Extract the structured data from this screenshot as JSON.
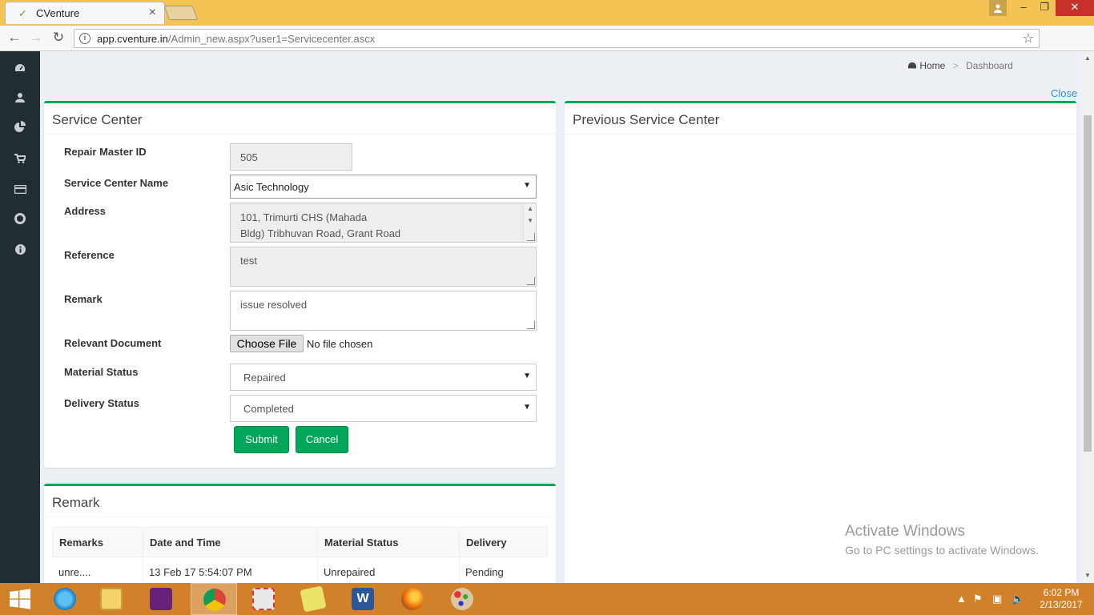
{
  "browser": {
    "tab_title": "CVenture",
    "url_host": "app.cventure.in",
    "url_path": "/Admin_new.aspx?user1=Servicecenter.ascx"
  },
  "breadcrumb": {
    "home": "Home",
    "separator": ">",
    "current": "Dashboard"
  },
  "close_label": "Close",
  "sidebar": {
    "items": [
      {
        "icon": "dashboard-icon"
      },
      {
        "icon": "user-icon"
      },
      {
        "icon": "pie-chart-icon"
      },
      {
        "icon": "cart-icon"
      },
      {
        "icon": "credit-card-icon"
      },
      {
        "icon": "support-icon"
      },
      {
        "icon": "info-icon"
      }
    ]
  },
  "service_center": {
    "title": "Service Center",
    "fields": {
      "repair_master_id_label": "Repair Master ID",
      "repair_master_id_value": "505",
      "service_center_name_label": "Service Center Name",
      "service_center_name_value": "Asic Technology",
      "address_label": "Address",
      "address_line1": "101, Trimurti CHS (Mahada",
      "address_line2": "Bldg) Tribhuvan Road, Grant Road",
      "reference_label": "Reference",
      "reference_value": "test",
      "remark_label": "Remark",
      "remark_value": "issue resolved",
      "relevant_document_label": "Relevant Document",
      "file_button": "Choose File",
      "file_status": "No file chosen",
      "material_status_label": "Material Status",
      "material_status_value": "Repaired",
      "delivery_status_label": "Delivery Status",
      "delivery_status_value": "Completed"
    },
    "submit_label": "Submit",
    "cancel_label": "Cancel"
  },
  "previous_service_center": {
    "title": "Previous Service Center"
  },
  "remark_box": {
    "title": "Remark",
    "columns": [
      "Remarks",
      "Date and Time",
      "Material Status",
      "Delivery"
    ],
    "rows": [
      [
        "unre....",
        "13 Feb 17 5:54:07 PM",
        "Unrepaired",
        "Pending"
      ]
    ]
  },
  "watermark": {
    "title": "Activate Windows",
    "subtitle": "Go to PC settings to activate Windows."
  },
  "taskbar": {
    "apps": [
      "internet-explorer-icon",
      "file-explorer-icon",
      "visual-studio-icon",
      "chrome-icon",
      "snipping-tool-icon",
      "sticky-notes-icon",
      "word-icon",
      "firefox-icon",
      "paint-icon"
    ],
    "time": "6:02 PM",
    "date": "2/13/2017"
  },
  "colors": {
    "accent": "#00a65a",
    "sidebar": "#222d32",
    "taskbar": "#d0812a",
    "titlebar": "#f3c453",
    "link": "#3c8dbc"
  }
}
